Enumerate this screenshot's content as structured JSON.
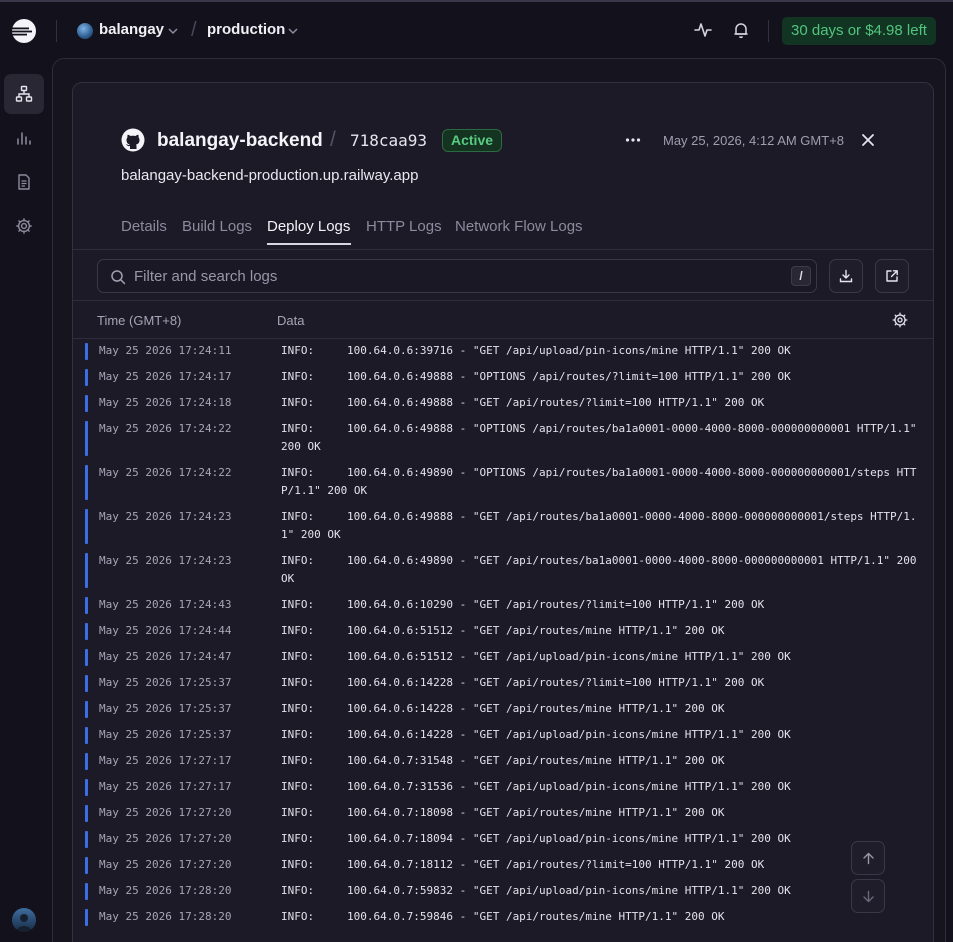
{
  "topbar": {
    "project": "balangay",
    "environment": "production",
    "trial": "30 days or $4.98 left"
  },
  "service": {
    "name": "balangay-backend",
    "commit": "718caa93",
    "status": "Active",
    "timestamp": "May 25, 2026, 4:12 AM GMT+8",
    "url": "balangay-backend-production.up.railway.app"
  },
  "tabs": [
    {
      "label": "Details"
    },
    {
      "label": "Build Logs"
    },
    {
      "label": "Deploy Logs"
    },
    {
      "label": "HTTP Logs"
    },
    {
      "label": "Network Flow Logs"
    }
  ],
  "search": {
    "placeholder": "Filter and search logs",
    "shortcut": "/"
  },
  "table": {
    "col_time": "Time (GMT+8)",
    "col_data": "Data"
  },
  "logs": [
    {
      "time": "May 25 2026 17:24:11",
      "level": "INFO:",
      "msg": "100.64.0.6:39716 - \"GET /api/upload/pin-icons/mine HTTP/1.1\" 200 OK"
    },
    {
      "time": "May 25 2026 17:24:17",
      "level": "INFO:",
      "msg": "100.64.0.6:49888 - \"OPTIONS /api/routes/?limit=100 HTTP/1.1\" 200 OK"
    },
    {
      "time": "May 25 2026 17:24:18",
      "level": "INFO:",
      "msg": "100.64.0.6:49888 - \"GET /api/routes/?limit=100 HTTP/1.1\" 200 OK"
    },
    {
      "time": "May 25 2026 17:24:22",
      "level": "INFO:",
      "msg": "100.64.0.6:49888 - \"OPTIONS /api/routes/ba1a0001-0000-4000-8000-000000000001 HTTP/1.1\" 200 OK"
    },
    {
      "time": "May 25 2026 17:24:22",
      "level": "INFO:",
      "msg": "100.64.0.6:49890 - \"OPTIONS /api/routes/ba1a0001-0000-4000-8000-000000000001/steps HTTP/1.1\" 200 OK"
    },
    {
      "time": "May 25 2026 17:24:23",
      "level": "INFO:",
      "msg": "100.64.0.6:49888 - \"GET /api/routes/ba1a0001-0000-4000-8000-000000000001/steps HTTP/1.1\" 200 OK"
    },
    {
      "time": "May 25 2026 17:24:23",
      "level": "INFO:",
      "msg": "100.64.0.6:49890 - \"GET /api/routes/ba1a0001-0000-4000-8000-000000000001 HTTP/1.1\" 200 OK"
    },
    {
      "time": "May 25 2026 17:24:43",
      "level": "INFO:",
      "msg": "100.64.0.6:10290 - \"GET /api/routes/?limit=100 HTTP/1.1\" 200 OK"
    },
    {
      "time": "May 25 2026 17:24:44",
      "level": "INFO:",
      "msg": "100.64.0.6:51512 - \"GET /api/routes/mine HTTP/1.1\" 200 OK"
    },
    {
      "time": "May 25 2026 17:24:47",
      "level": "INFO:",
      "msg": "100.64.0.6:51512 - \"GET /api/upload/pin-icons/mine HTTP/1.1\" 200 OK"
    },
    {
      "time": "May 25 2026 17:25:37",
      "level": "INFO:",
      "msg": "100.64.0.6:14228 - \"GET /api/routes/?limit=100 HTTP/1.1\" 200 OK"
    },
    {
      "time": "May 25 2026 17:25:37",
      "level": "INFO:",
      "msg": "100.64.0.6:14228 - \"GET /api/routes/mine HTTP/1.1\" 200 OK"
    },
    {
      "time": "May 25 2026 17:25:37",
      "level": "INFO:",
      "msg": "100.64.0.6:14228 - \"GET /api/upload/pin-icons/mine HTTP/1.1\" 200 OK"
    },
    {
      "time": "May 25 2026 17:27:17",
      "level": "INFO:",
      "msg": "100.64.0.7:31548 - \"GET /api/routes/mine HTTP/1.1\" 200 OK"
    },
    {
      "time": "May 25 2026 17:27:17",
      "level": "INFO:",
      "msg": "100.64.0.7:31536 - \"GET /api/upload/pin-icons/mine HTTP/1.1\" 200 OK"
    },
    {
      "time": "May 25 2026 17:27:20",
      "level": "INFO:",
      "msg": "100.64.0.7:18098 - \"GET /api/routes/mine HTTP/1.1\" 200 OK"
    },
    {
      "time": "May 25 2026 17:27:20",
      "level": "INFO:",
      "msg": "100.64.0.7:18094 - \"GET /api/upload/pin-icons/mine HTTP/1.1\" 200 OK"
    },
    {
      "time": "May 25 2026 17:27:20",
      "level": "INFO:",
      "msg": "100.64.0.7:18112 - \"GET /api/routes/?limit=100 HTTP/1.1\" 200 OK"
    },
    {
      "time": "May 25 2026 17:28:20",
      "level": "INFO:",
      "msg": "100.64.0.7:59832 - \"GET /api/upload/pin-icons/mine HTTP/1.1\" 200 OK"
    },
    {
      "time": "May 25 2026 17:28:20",
      "level": "INFO:",
      "msg": "100.64.0.7:59846 - \"GET /api/routes/mine HTTP/1.1\" 200 OK"
    }
  ],
  "icons": {
    "logo": "railway-logo-icon",
    "activity": "activity-pulse-icon",
    "bell": "bell-icon",
    "architecture": "architecture-icon",
    "metrics": "bar-chart-icon",
    "docs": "document-icon",
    "settings": "gear-icon"
  },
  "colors": {
    "accent_log_bar": "#3c6ee8",
    "status_active": "#58cb82",
    "trial_text": "#52c47e"
  }
}
